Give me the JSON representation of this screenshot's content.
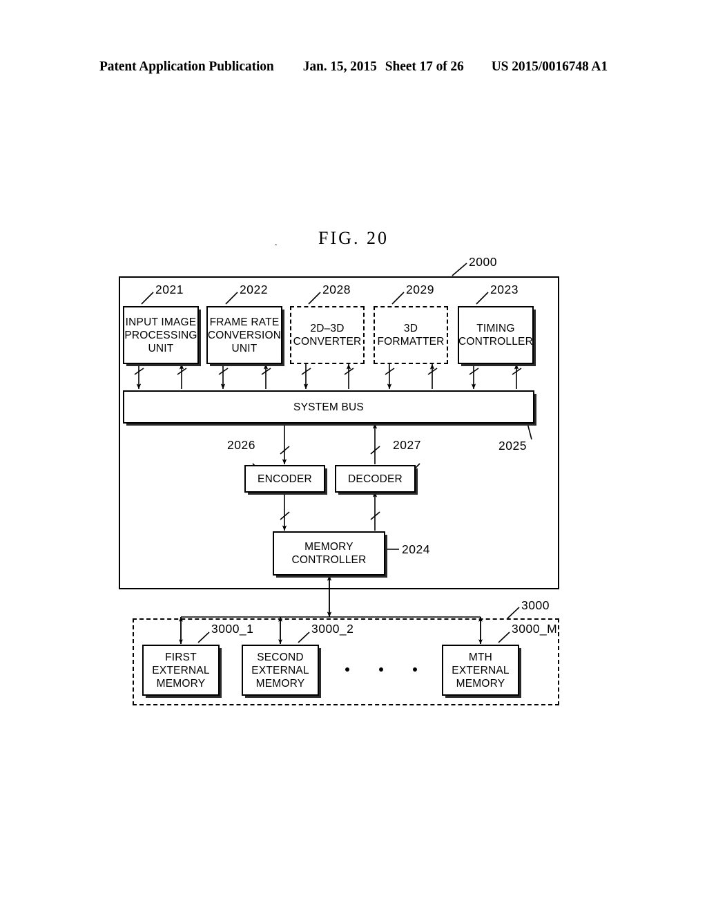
{
  "header": {
    "left": "Patent Application Publication",
    "date": "Jan. 15, 2015",
    "sheet": "Sheet 17 of 26",
    "number": "US 2015/0016748 A1"
  },
  "figure": {
    "title": "FIG. 20",
    "dot": "."
  },
  "diagram": {
    "system_ref": "2000",
    "memory_group_ref": "3000",
    "bus": {
      "label": "SYSTEM BUS",
      "ref": "2025"
    },
    "top_blocks": [
      {
        "ref": "2021",
        "lines": [
          "INPUT IMAGE",
          "PROCESSING",
          "UNIT"
        ],
        "style": "solid"
      },
      {
        "ref": "2022",
        "lines": [
          "FRAME RATE",
          "CONVERSION",
          "UNIT"
        ],
        "style": "solid"
      },
      {
        "ref": "2028",
        "lines": [
          "2D–3D",
          "CONVERTER"
        ],
        "style": "dashed"
      },
      {
        "ref": "2029",
        "lines": [
          "3D",
          "FORMATTER"
        ],
        "style": "dashed"
      },
      {
        "ref": "2023",
        "lines": [
          "TIMING",
          "CONTROLLER"
        ],
        "style": "solid"
      }
    ],
    "codec_blocks": [
      {
        "ref": "2026",
        "lines": [
          "ENCODER"
        ],
        "style": "solid"
      },
      {
        "ref": "2027",
        "lines": [
          "DECODER"
        ],
        "style": "solid"
      }
    ],
    "memory_controller": {
      "ref": "2024",
      "lines": [
        "MEMORY",
        "CONTROLLER"
      ],
      "style": "solid"
    },
    "external_memories": [
      {
        "ref": "3000_1",
        "lines": [
          "FIRST",
          "EXTERNAL",
          "MEMORY"
        ],
        "style": "solid"
      },
      {
        "ref": "3000_2",
        "lines": [
          "SECOND",
          "EXTERNAL",
          "MEMORY"
        ],
        "style": "solid"
      },
      {
        "ref": "3000_M",
        "lines": [
          "MTH",
          "EXTERNAL",
          "MEMORY"
        ],
        "style": "solid"
      }
    ],
    "ellipsis": "• • •"
  },
  "colors": {
    "ink": "#000000",
    "paper": "#ffffff",
    "shadow": "#2a2a2a"
  }
}
